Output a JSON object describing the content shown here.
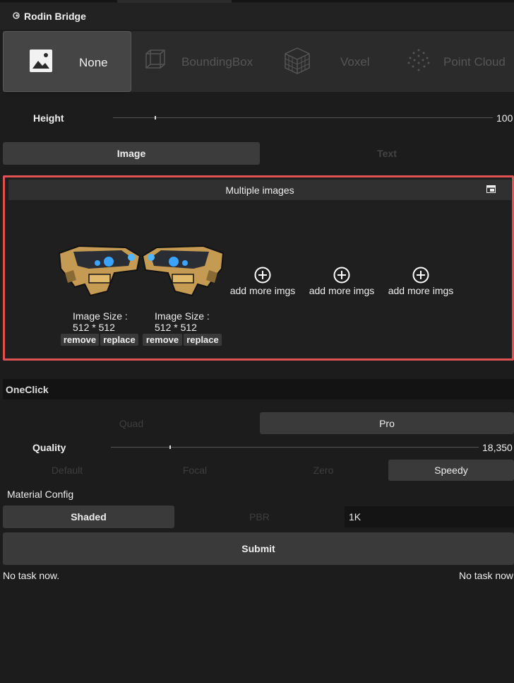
{
  "window": {
    "title": "Rodin Bridge"
  },
  "modes": [
    {
      "label": "None",
      "icon": "image-icon",
      "active": true
    },
    {
      "label": "BoundingBox",
      "icon": "cube-icon",
      "active": false
    },
    {
      "label": "Voxel",
      "icon": "voxel-icon",
      "active": false
    },
    {
      "label": "Point Cloud",
      "icon": "point-cloud-icon",
      "active": false
    }
  ],
  "height": {
    "label": "Height",
    "value": "100",
    "fraction": 0.11
  },
  "input_tabs": {
    "image": "Image",
    "text": "Text",
    "active": "Image"
  },
  "images_panel": {
    "title": "Multiple images",
    "images": [
      {
        "size_label": "Image Size :",
        "size_value": "512 * 512",
        "remove": "remove",
        "replace": "replace"
      },
      {
        "size_label": "Image Size :",
        "size_value": "512 * 512",
        "remove": "remove",
        "replace": "replace"
      }
    ],
    "add_slots": [
      "add more imgs",
      "add more imgs",
      "add more imgs"
    ]
  },
  "oneclick": {
    "title": "OneClick",
    "mesh_modes": {
      "quad": "Quad",
      "pro": "Pro",
      "active": "Pro"
    },
    "quality": {
      "label": "Quality",
      "value": "18,350",
      "fraction": 0.16
    },
    "presets": [
      "Default",
      "Focal",
      "Zero",
      "Speedy"
    ],
    "active_preset": "Speedy",
    "material_config_label": "Material Config",
    "material": {
      "shaded": "Shaded",
      "pbr": "PBR",
      "active": "Shaded"
    },
    "resolution": "1K",
    "submit": "Submit"
  },
  "status": {
    "left": "No task now.",
    "right": "No task now"
  },
  "colors": {
    "highlight": "#e05252",
    "active_tab": "#3c3c3c",
    "background": "#1c1c1c"
  }
}
